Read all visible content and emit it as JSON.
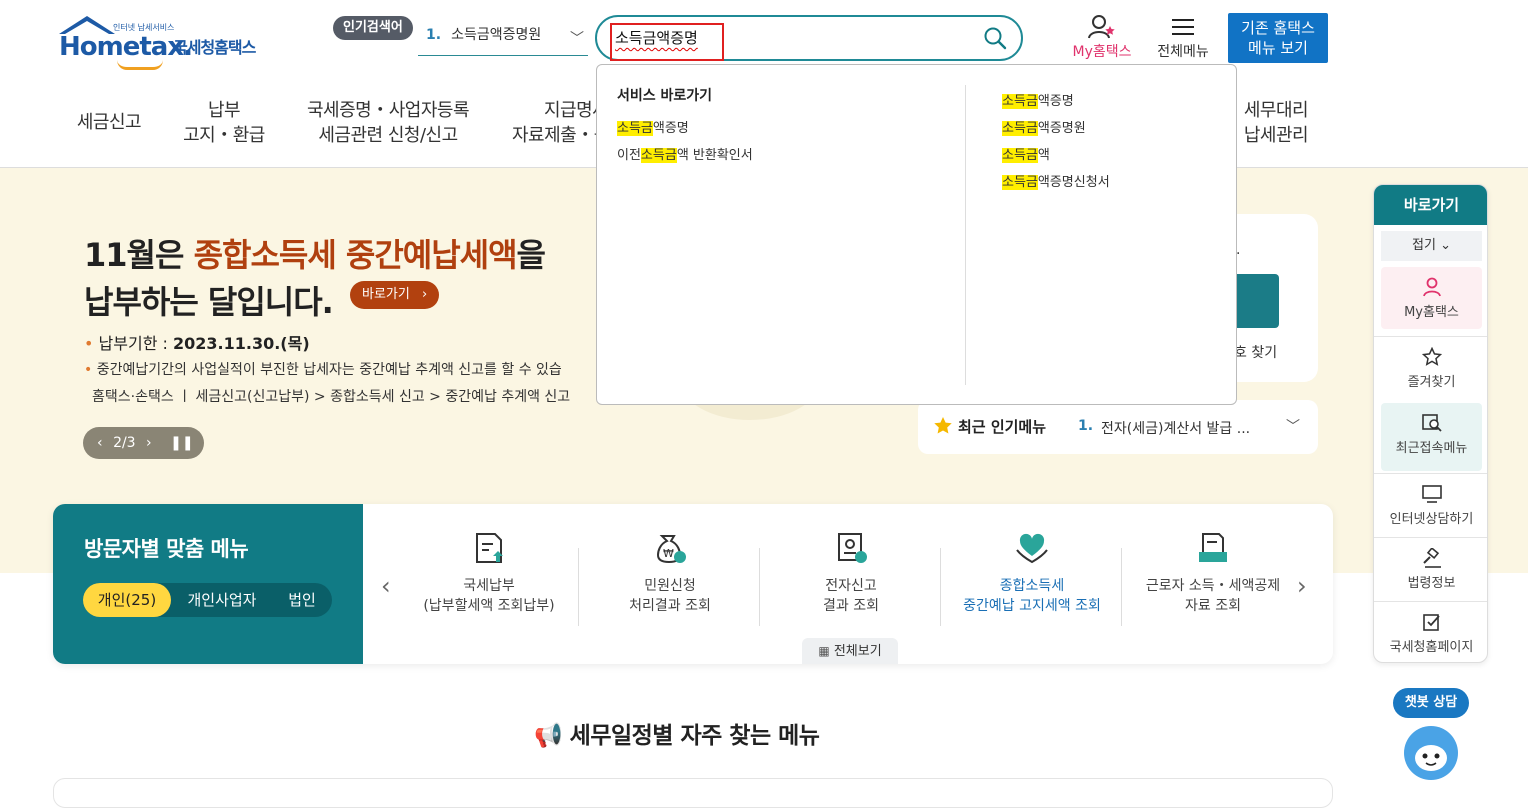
{
  "header": {
    "logo_sub": "인터넷 납세서비스",
    "logo_word": "Hometax.",
    "logo_kor": "국세청홈택스",
    "popular_badge": "인기검색어",
    "popular_rank_num": "1.",
    "popular_rank_text": "소득금액증명원",
    "search_value": "소득금액증명",
    "my_hometax": "My홈택스",
    "all_menu": "전체메뉴",
    "old_hometax_line1": "기존 홈택스",
    "old_hometax_line2": "메뉴 보기"
  },
  "nav": {
    "items": [
      {
        "line1": "세금신고",
        "line2": ""
      },
      {
        "line1": "납부",
        "line2": "고지・환급"
      },
      {
        "line1": "국세증명・사업자등록",
        "line2": "세금관련 신청/신고"
      },
      {
        "line1": "지급명세",
        "line2": "자료제출・공"
      },
      {
        "line1": "세무대리",
        "line2": "납세관리"
      }
    ]
  },
  "hero": {
    "title_pre": "11월은 ",
    "title_em": "종합소득세 중간예납세액",
    "title_post": "을",
    "title_line2": "납부하는 달입니다.",
    "go_button": "바로가기",
    "due_label": "납부기한 : ",
    "due_value": "2023.11.30.(목)",
    "note": "중간예납기간의 사업실적이 부진한 납세자는 중간예납 추계액 신고를 할 수 있습",
    "path": "홈택스·손택스 ㅣ 세금신고(신고납부) > 종합소득세 신고 > 중간예납 추계액 신고",
    "pager": "2/3"
  },
  "login_card": {
    "find_text": "호 찾기",
    "dot_text": "."
  },
  "recent_menu": {
    "title": "최근 인기메뉴",
    "num": "1.",
    "value": "전자(세금)계산서 발급 ..."
  },
  "dropdown": {
    "heading": "서비스 바로가기",
    "left": [
      {
        "pre": "",
        "hl": "소득금",
        "post": "액증명"
      },
      {
        "pre": "이전",
        "hl": "소득금",
        "post": "액 반환확인서"
      }
    ],
    "right": [
      {
        "pre": "",
        "hl": "소득금",
        "post": "액증명"
      },
      {
        "pre": "",
        "hl": "소득금",
        "post": "액증명원"
      },
      {
        "pre": "",
        "hl": "소득금",
        "post": "액"
      },
      {
        "pre": "",
        "hl": "소득금",
        "post": "액증명신청서"
      }
    ]
  },
  "visitor": {
    "title": "방문자별 맞춤 메뉴",
    "tabs": [
      "개인(25)",
      "개인사업자",
      "법인"
    ],
    "items": [
      {
        "line1": "국세납부",
        "line2": "(납부할세액 조회납부)",
        "icon": "tax-payment-icon"
      },
      {
        "line1": "민원신청",
        "line2": "처리결과 조회",
        "icon": "money-bag-icon"
      },
      {
        "line1": "전자신고",
        "line2": "결과 조회",
        "icon": "e-filing-icon"
      },
      {
        "line1": "종합소득세",
        "line2": "중간예납 고지세액 조회",
        "icon": "heart-hands-icon"
      },
      {
        "line1": "근로자 소득・세액공제",
        "line2": "자료 조회",
        "icon": "document-icon"
      }
    ],
    "see_all": "전체보기"
  },
  "schedule": {
    "title": "세무일정별 자주 찾는 메뉴"
  },
  "quick": {
    "head": "바로가기",
    "fold": "접기",
    "items": [
      {
        "label": "My홈택스",
        "icon": "user-icon"
      },
      {
        "label": "즐겨찾기",
        "icon": "star-icon"
      },
      {
        "label": "최근접속메뉴",
        "icon": "recent-search-icon"
      },
      {
        "label": "인터넷상담하기",
        "icon": "monitor-icon"
      },
      {
        "label": "법령정보",
        "icon": "gavel-icon"
      },
      {
        "label": "국세청홈페이지",
        "icon": "checklist-icon"
      }
    ]
  },
  "chatbot": {
    "label": "챗봇 상담"
  },
  "colors": {
    "teal": "#117b85",
    "brand_blue": "#1d5aa6",
    "accent_orange": "#b0400f",
    "highlight": "#ffee00",
    "hero_bg": "#fbf6e3"
  }
}
